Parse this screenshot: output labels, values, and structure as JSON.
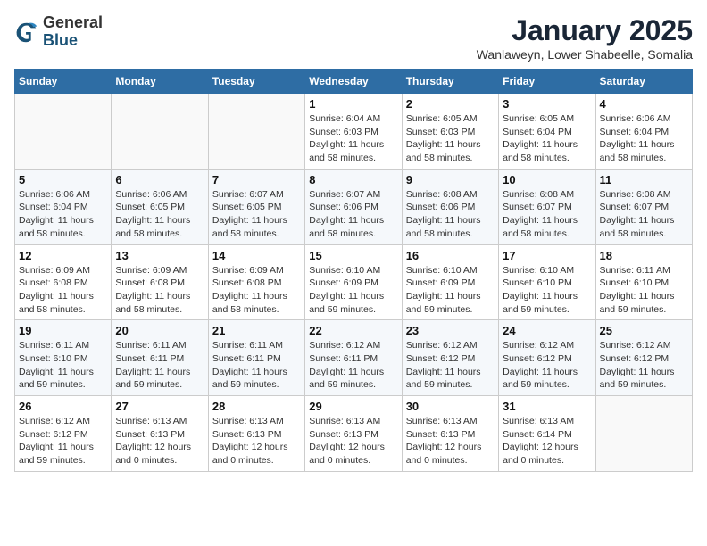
{
  "logo": {
    "general": "General",
    "blue": "Blue"
  },
  "header": {
    "month_title": "January 2025",
    "subtitle": "Wanlaweyn, Lower Shabeelle, Somalia"
  },
  "weekdays": [
    "Sunday",
    "Monday",
    "Tuesday",
    "Wednesday",
    "Thursday",
    "Friday",
    "Saturday"
  ],
  "weeks": [
    [
      {
        "day": "",
        "info": ""
      },
      {
        "day": "",
        "info": ""
      },
      {
        "day": "",
        "info": ""
      },
      {
        "day": "1",
        "info": "Sunrise: 6:04 AM\nSunset: 6:03 PM\nDaylight: 11 hours\nand 58 minutes."
      },
      {
        "day": "2",
        "info": "Sunrise: 6:05 AM\nSunset: 6:03 PM\nDaylight: 11 hours\nand 58 minutes."
      },
      {
        "day": "3",
        "info": "Sunrise: 6:05 AM\nSunset: 6:04 PM\nDaylight: 11 hours\nand 58 minutes."
      },
      {
        "day": "4",
        "info": "Sunrise: 6:06 AM\nSunset: 6:04 PM\nDaylight: 11 hours\nand 58 minutes."
      }
    ],
    [
      {
        "day": "5",
        "info": "Sunrise: 6:06 AM\nSunset: 6:04 PM\nDaylight: 11 hours\nand 58 minutes."
      },
      {
        "day": "6",
        "info": "Sunrise: 6:06 AM\nSunset: 6:05 PM\nDaylight: 11 hours\nand 58 minutes."
      },
      {
        "day": "7",
        "info": "Sunrise: 6:07 AM\nSunset: 6:05 PM\nDaylight: 11 hours\nand 58 minutes."
      },
      {
        "day": "8",
        "info": "Sunrise: 6:07 AM\nSunset: 6:06 PM\nDaylight: 11 hours\nand 58 minutes."
      },
      {
        "day": "9",
        "info": "Sunrise: 6:08 AM\nSunset: 6:06 PM\nDaylight: 11 hours\nand 58 minutes."
      },
      {
        "day": "10",
        "info": "Sunrise: 6:08 AM\nSunset: 6:07 PM\nDaylight: 11 hours\nand 58 minutes."
      },
      {
        "day": "11",
        "info": "Sunrise: 6:08 AM\nSunset: 6:07 PM\nDaylight: 11 hours\nand 58 minutes."
      }
    ],
    [
      {
        "day": "12",
        "info": "Sunrise: 6:09 AM\nSunset: 6:08 PM\nDaylight: 11 hours\nand 58 minutes."
      },
      {
        "day": "13",
        "info": "Sunrise: 6:09 AM\nSunset: 6:08 PM\nDaylight: 11 hours\nand 58 minutes."
      },
      {
        "day": "14",
        "info": "Sunrise: 6:09 AM\nSunset: 6:08 PM\nDaylight: 11 hours\nand 58 minutes."
      },
      {
        "day": "15",
        "info": "Sunrise: 6:10 AM\nSunset: 6:09 PM\nDaylight: 11 hours\nand 59 minutes."
      },
      {
        "day": "16",
        "info": "Sunrise: 6:10 AM\nSunset: 6:09 PM\nDaylight: 11 hours\nand 59 minutes."
      },
      {
        "day": "17",
        "info": "Sunrise: 6:10 AM\nSunset: 6:10 PM\nDaylight: 11 hours\nand 59 minutes."
      },
      {
        "day": "18",
        "info": "Sunrise: 6:11 AM\nSunset: 6:10 PM\nDaylight: 11 hours\nand 59 minutes."
      }
    ],
    [
      {
        "day": "19",
        "info": "Sunrise: 6:11 AM\nSunset: 6:10 PM\nDaylight: 11 hours\nand 59 minutes."
      },
      {
        "day": "20",
        "info": "Sunrise: 6:11 AM\nSunset: 6:11 PM\nDaylight: 11 hours\nand 59 minutes."
      },
      {
        "day": "21",
        "info": "Sunrise: 6:11 AM\nSunset: 6:11 PM\nDaylight: 11 hours\nand 59 minutes."
      },
      {
        "day": "22",
        "info": "Sunrise: 6:12 AM\nSunset: 6:11 PM\nDaylight: 11 hours\nand 59 minutes."
      },
      {
        "day": "23",
        "info": "Sunrise: 6:12 AM\nSunset: 6:12 PM\nDaylight: 11 hours\nand 59 minutes."
      },
      {
        "day": "24",
        "info": "Sunrise: 6:12 AM\nSunset: 6:12 PM\nDaylight: 11 hours\nand 59 minutes."
      },
      {
        "day": "25",
        "info": "Sunrise: 6:12 AM\nSunset: 6:12 PM\nDaylight: 11 hours\nand 59 minutes."
      }
    ],
    [
      {
        "day": "26",
        "info": "Sunrise: 6:12 AM\nSunset: 6:12 PM\nDaylight: 11 hours\nand 59 minutes."
      },
      {
        "day": "27",
        "info": "Sunrise: 6:13 AM\nSunset: 6:13 PM\nDaylight: 12 hours\nand 0 minutes."
      },
      {
        "day": "28",
        "info": "Sunrise: 6:13 AM\nSunset: 6:13 PM\nDaylight: 12 hours\nand 0 minutes."
      },
      {
        "day": "29",
        "info": "Sunrise: 6:13 AM\nSunset: 6:13 PM\nDaylight: 12 hours\nand 0 minutes."
      },
      {
        "day": "30",
        "info": "Sunrise: 6:13 AM\nSunset: 6:13 PM\nDaylight: 12 hours\nand 0 minutes."
      },
      {
        "day": "31",
        "info": "Sunrise: 6:13 AM\nSunset: 6:14 PM\nDaylight: 12 hours\nand 0 minutes."
      },
      {
        "day": "",
        "info": ""
      }
    ]
  ]
}
